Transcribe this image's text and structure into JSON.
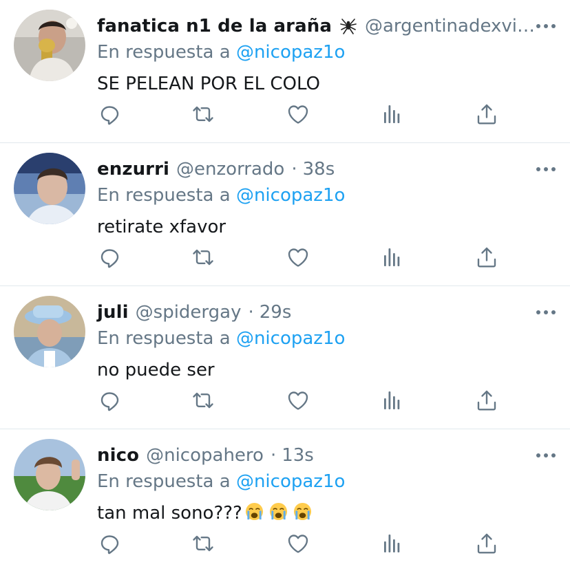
{
  "colors": {
    "link": "#1da1f2",
    "secondary_text": "#657786",
    "primary_text": "#14171a",
    "divider": "#e1e8ed"
  },
  "replies": [
    {
      "display_name": "fanatica n1 de la araña",
      "has_badge_emoji": "spider-emoji",
      "handle": "@argentinadexvid…",
      "time": "",
      "reply_prefix": "En respuesta a",
      "reply_to": "@nicopaz1o",
      "text": "SE PELEAN POR EL COLO",
      "avatar": "young man kissing trophy"
    },
    {
      "display_name": "enzurri",
      "handle": "@enzorrado",
      "separator": "·",
      "time": "38s",
      "reply_prefix": "En respuesta a",
      "reply_to": "@nicopaz1o",
      "text": "retirate xfavor",
      "avatar": "young man in stadium with blue flag"
    },
    {
      "display_name": "juli",
      "handle": "@spidergay",
      "separator": "·",
      "time": "29s",
      "reply_prefix": "En respuesta a",
      "reply_to": "@nicopaz1o",
      "text": "no puede ser",
      "avatar": "boy with light blue hat"
    },
    {
      "display_name": "nico",
      "handle": "@nicopahero",
      "separator": "·",
      "time": "13s",
      "reply_prefix": "En respuesta a",
      "reply_to": "@nicopaz1o",
      "text": "tan mal sono???",
      "trailing_emojis": [
        "loudly-crying-face",
        "loudly-crying-face",
        "loudly-crying-face"
      ],
      "avatar": "young man selfie on football pitch"
    }
  ],
  "action_icons": [
    "reply-icon",
    "retweet-icon",
    "like-icon",
    "analytics-icon",
    "share-icon"
  ]
}
